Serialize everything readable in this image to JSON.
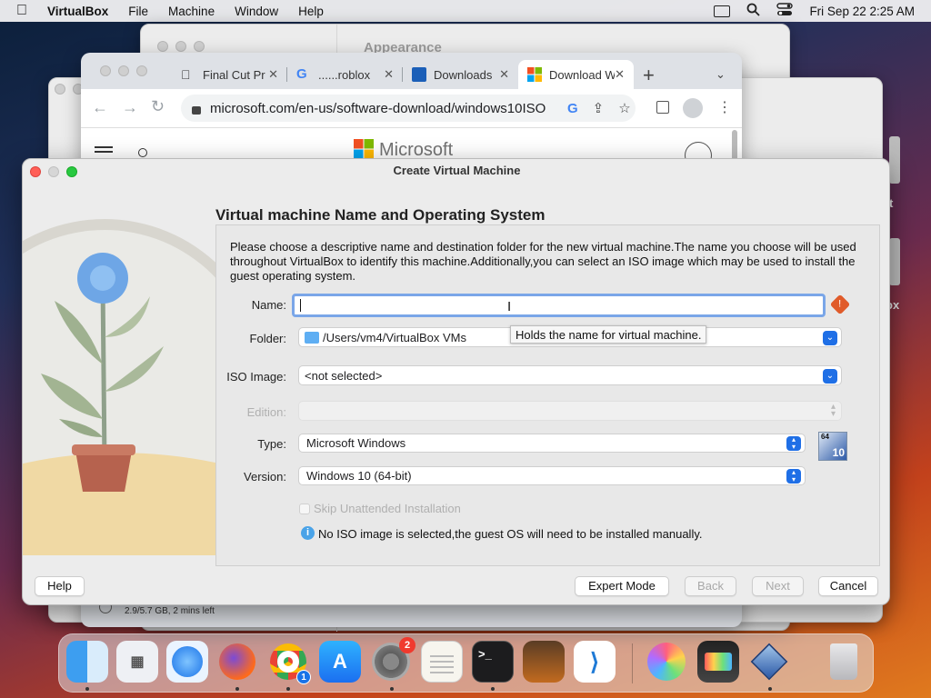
{
  "menubar": {
    "app_name": "VirtualBox",
    "items": [
      "File",
      "Machine",
      "Window",
      "Help"
    ],
    "clock": "Fri Sep 22  2:25 AM"
  },
  "background": {
    "appearance_title": "Appearance",
    "download_status": "2.9/5.7 GB, 2 mins left",
    "side_text_1": "t",
    "side_text_2": "ox"
  },
  "browser": {
    "tabs": [
      {
        "label": "Final Cut Pr",
        "icon": "apple-icon"
      },
      {
        "label": "......roblox",
        "icon": "google-icon"
      },
      {
        "label": "Downloads",
        "icon": "windows-icon"
      },
      {
        "label": "Download W",
        "icon": "microsoft-icon"
      }
    ],
    "url": "microsoft.com/en-us/software-download/windows10ISO",
    "page_logo": "Microsoft"
  },
  "dialog": {
    "title": "Create Virtual Machine",
    "heading": "Virtual machine Name and Operating System",
    "description": "Please choose a descriptive name and destination folder for the new virtual machine.The name you choose will be used throughout VirtualBox to identify this machine.Additionally,you can select an ISO image which may be used to install the guest operating system.",
    "name_label": "Name:",
    "name_value": "",
    "name_tooltip": "Holds the name for virtual machine.",
    "folder_label": "Folder:",
    "folder_value": "/Users/vm4/VirtualBox VMs",
    "iso_label": "ISO Image:",
    "iso_value": "<not selected>",
    "edition_label": "Edition:",
    "edition_value": "",
    "type_label": "Type:",
    "type_value": "Microsoft Windows",
    "version_label": "Version:",
    "version_value": "Windows 10 (64-bit)",
    "os_badge_top": "64",
    "os_badge_bottom": "10",
    "skip_label": "Skip Unattended Installation",
    "info_text": "No ISO image is selected,the guest OS will need to be installed manually.",
    "buttons": {
      "help": "Help",
      "expert": "Expert Mode",
      "back": "Back",
      "next": "Next",
      "cancel": "Cancel"
    }
  },
  "dock": {
    "settings_badge": "2",
    "chrome_badge": "1",
    "apps": [
      "Finder",
      "Launchpad",
      "Safari",
      "Firefox",
      "Chrome",
      "App Store",
      "System Settings",
      "TextEdit",
      "Terminal",
      "GarageBand",
      "VS Code",
      "Pixelmator",
      "Final Cut Pro",
      "VirtualBox",
      "Trash"
    ]
  }
}
